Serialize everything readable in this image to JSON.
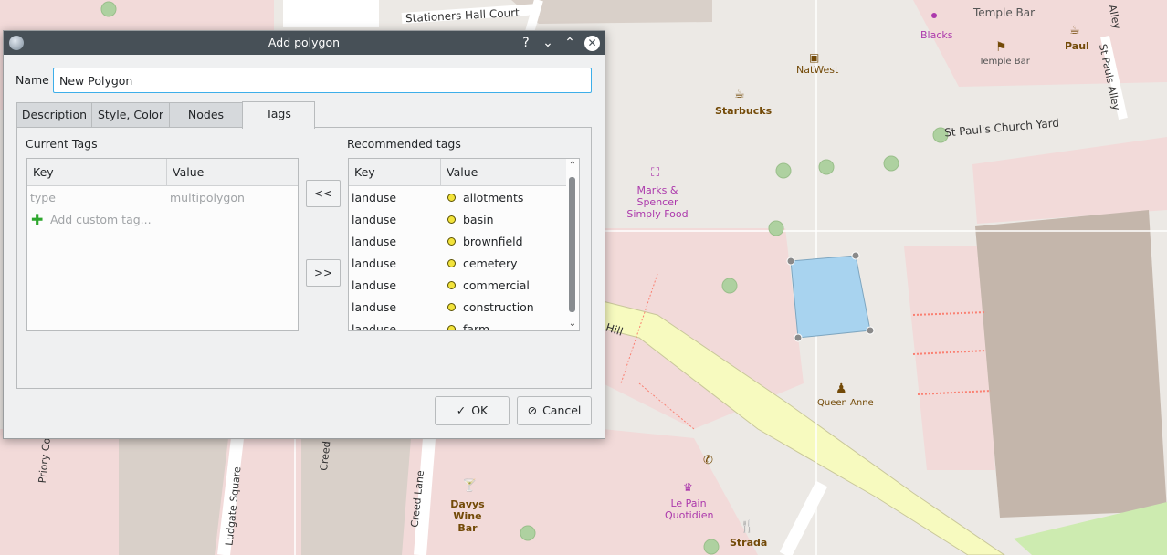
{
  "map": {
    "streets": {
      "stationers": "Stationers Hall Court",
      "st_pauls_church_yard": "St Paul's Church Yard",
      "st_pauls_alley": "St Pauls Alley",
      "alley_top": "Alley",
      "ludgate_hill": "Ludgate Hill",
      "ludgate_square": "Ludgate Square",
      "creed_lane": "Creed Lane",
      "creed_partial": "Creed",
      "priory_court": "Priory Co"
    },
    "pois": {
      "temple_bar_top": "Temple Bar",
      "temple_bar": "Temple Bar",
      "blacks": "Blacks",
      "paul": "Paul",
      "natwest": "NatWest",
      "starbucks": "Starbucks",
      "marks_spencer": "Marks & Spencer Simply Food",
      "queen_anne": "Queen Anne",
      "davys_wine_bar": "Davys Wine Bar",
      "le_pain_quotidien": "Le Pain Quotidien",
      "strada": "Strada"
    }
  },
  "dialog": {
    "title": "Add polygon",
    "help": "?",
    "minimize": "⌄",
    "maximize": "⌃",
    "close": "✕",
    "name_label": "Name",
    "name_value": "New Polygon",
    "tabs": [
      "Description",
      "Style, Color",
      "Nodes",
      "Tags"
    ],
    "current_tags": {
      "label": "Current Tags",
      "headers": [
        "Key",
        "Value"
      ],
      "rows": [
        {
          "key": "type",
          "value": "multipolygon"
        }
      ],
      "add_custom": "Add custom tag..."
    },
    "move_left": "<<",
    "move_right": ">>",
    "recommended": {
      "label": "Recommended tags",
      "headers": [
        "Key",
        "Value"
      ],
      "rows": [
        {
          "key": "landuse",
          "value": "allotments"
        },
        {
          "key": "landuse",
          "value": "basin"
        },
        {
          "key": "landuse",
          "value": "brownfield"
        },
        {
          "key": "landuse",
          "value": "cemetery"
        },
        {
          "key": "landuse",
          "value": "commercial"
        },
        {
          "key": "landuse",
          "value": "construction"
        },
        {
          "key": "landuse",
          "value": "farm"
        }
      ]
    },
    "ok": "OK",
    "cancel": "Cancel"
  }
}
